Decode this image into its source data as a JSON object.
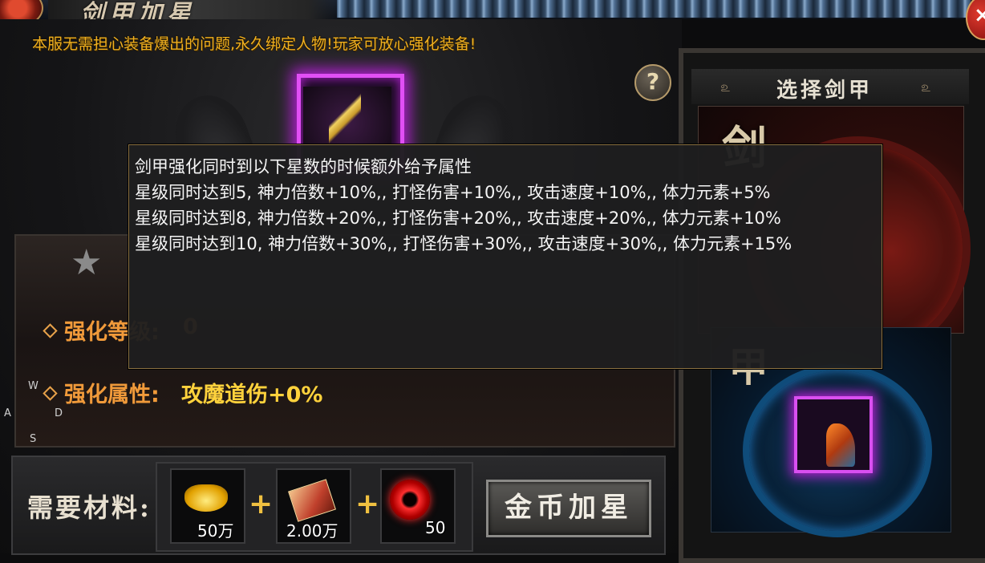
{
  "header": {
    "title": "剑甲加星",
    "close_label": "×"
  },
  "notice": "本服无需担心装备爆出的问题,永久绑定人物!玩家可放心强化装备!",
  "help_label": "?",
  "tooltip": {
    "lines": [
      "剑甲强化同时到以下星数的时候额外给予属性",
      "星级同时达到5, 神力倍数+10%,, 打怪伤害+10%,, 攻击速度+10%,, 体力元素+5%",
      "星级同时达到8, 神力倍数+20%,, 打怪伤害+20%,, 攻击速度+20%,, 体力元素+10%",
      "星级同时达到10, 神力倍数+30%,, 打怪伤害+30%,, 攻击速度+30%,, 体力元素+15%"
    ]
  },
  "enhance": {
    "level_label": "强化等级:",
    "level_value": "0",
    "attr_label": "强化属性:",
    "attr_value": "攻魔道伤+0%"
  },
  "keys": {
    "w": "W",
    "a": "A",
    "s": "S",
    "d": "D"
  },
  "materials": {
    "label": "需要材料:",
    "items": [
      {
        "icon": "gold-ingot-icon",
        "count": "50万"
      },
      {
        "icon": "scroll-book-icon",
        "count": "2.00万"
      },
      {
        "icon": "red-orb-icon",
        "count": "50"
      }
    ],
    "plus": "+"
  },
  "coin_button_label": "金币加星",
  "right_panel": {
    "title": "选择剑甲",
    "card_sword_char": "剑",
    "card_armor_char": "甲"
  },
  "colors": {
    "notice": "#f0b020",
    "label_orange": "#f09a3a",
    "value_gold": "#ffd23c",
    "item_frame": "#e14ff5"
  }
}
